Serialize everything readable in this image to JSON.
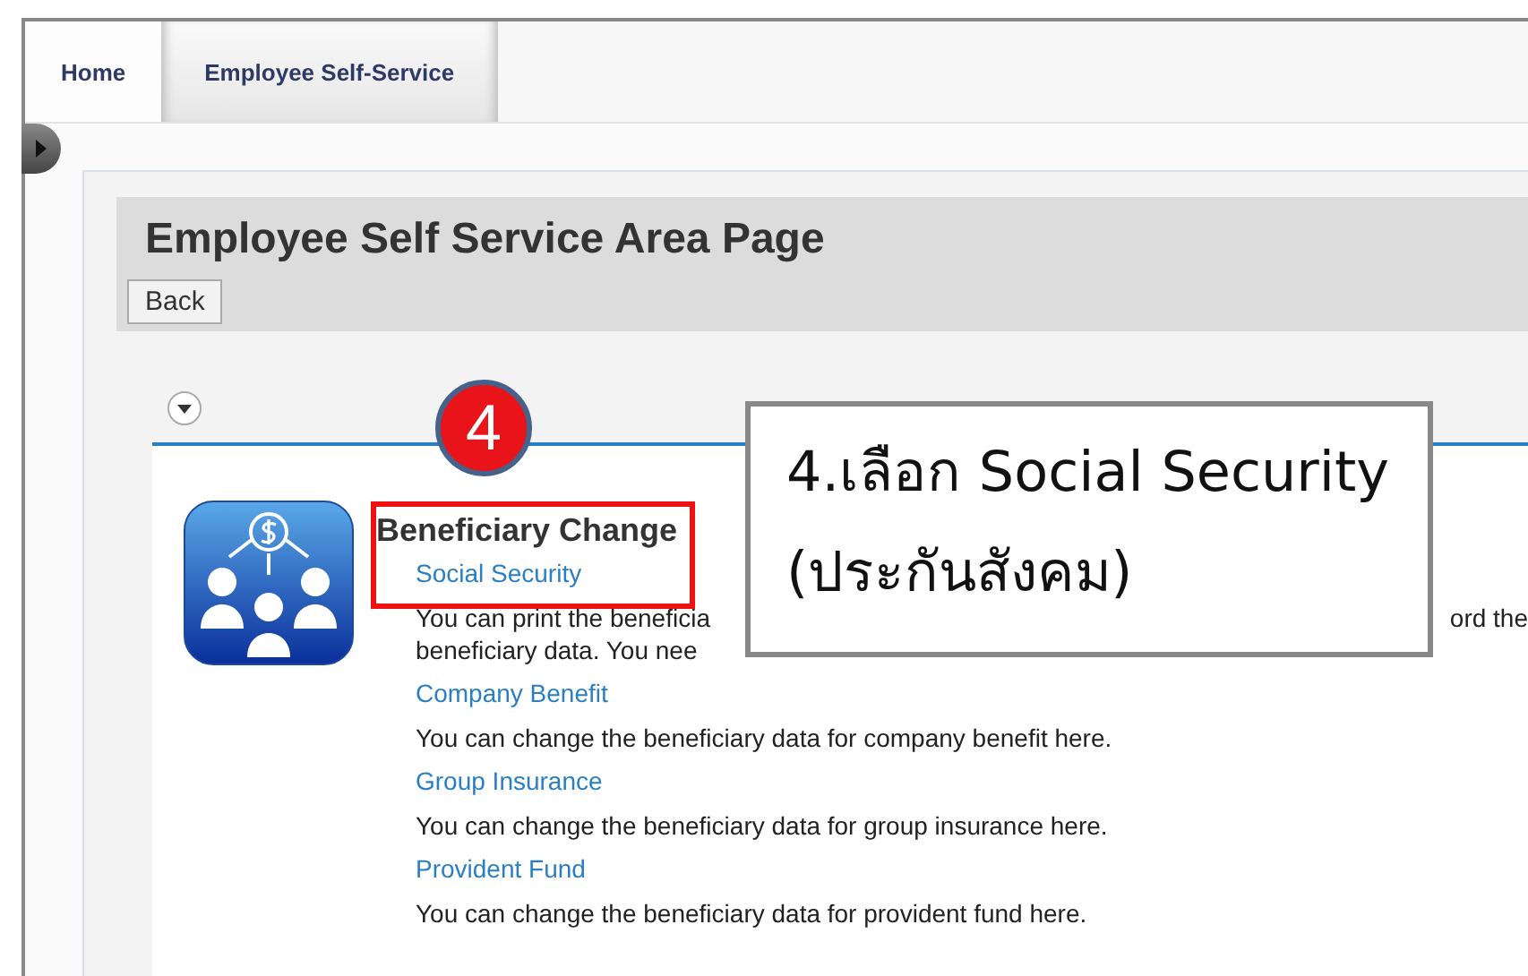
{
  "tabs": [
    {
      "label": "Home",
      "selected": false
    },
    {
      "label": "Employee Self-Service",
      "selected": true
    }
  ],
  "page": {
    "title": "Employee Self Service Area Page",
    "back_button": "Back"
  },
  "section": {
    "heading": "Beneficiary Change",
    "services": [
      {
        "link": "Social Security",
        "description_lines": [
          [
            "You can print the beneficia",
            "ord the"
          ],
          [
            "beneficiary data. You nee"
          ]
        ]
      },
      {
        "link": "Company Benefit",
        "description_lines": [
          [
            "You can change the beneficiary data for company benefit here."
          ]
        ]
      },
      {
        "link": "Group Insurance",
        "description_lines": [
          [
            "You can change the beneficiary data for group insurance here."
          ]
        ]
      },
      {
        "link": "Provident Fund",
        "description_lines": [
          [
            "You can change the beneficiary data for provident fund here."
          ]
        ]
      }
    ]
  },
  "annotation": {
    "step": "4",
    "callout": [
      "4.เลือก Social Security",
      "(ประกันสังคม)"
    ]
  }
}
